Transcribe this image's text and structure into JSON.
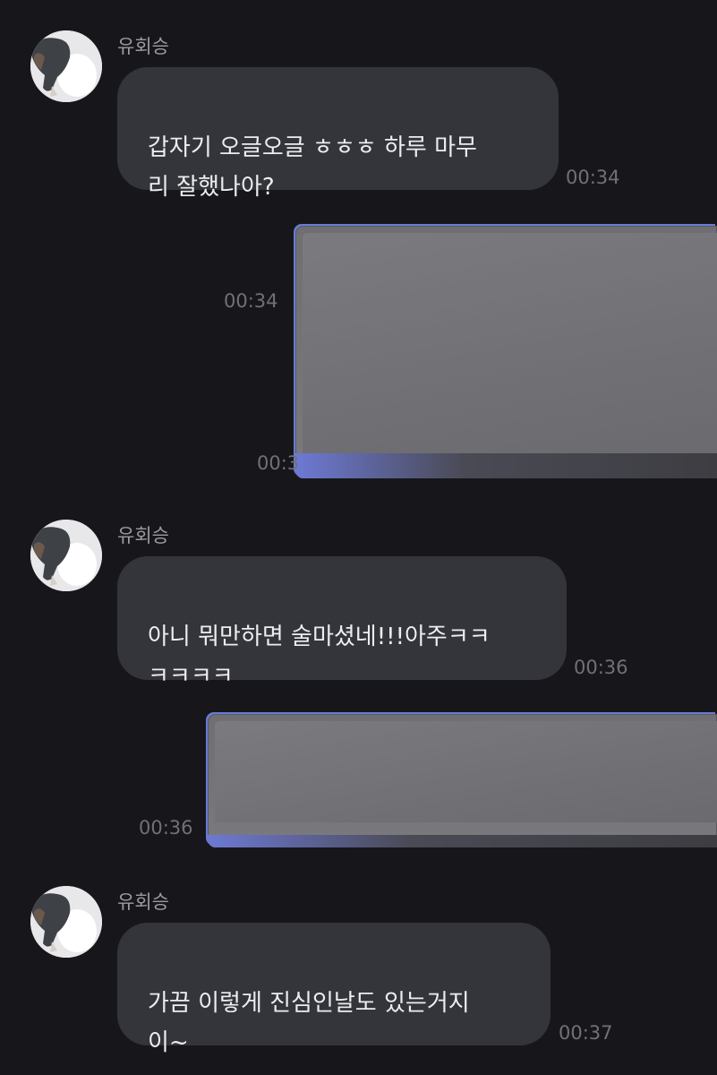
{
  "messages": [
    {
      "sender": "유회승",
      "text": "갑자기 오글오글 ㅎㅎㅎ 하루 마무\n리 잘했나아?",
      "time": "00:34"
    },
    {
      "outgoing_blocked": true,
      "time": "00:34",
      "time_partial": "00:3"
    },
    {
      "sender": "유회승",
      "text": "아니 뭐만하면 술마셨네!!!아주ㅋㅋ\nㅋㅋㅋㅋ",
      "time": "00:36"
    },
    {
      "outgoing_blocked": true,
      "time": "00:36"
    },
    {
      "sender": "유회승",
      "text": "가끔 이렇게 진심인날도 있는거지\n이~",
      "time": "00:37"
    }
  ],
  "colors": {
    "background": "#17171b",
    "bubble": "#34353b",
    "text": "#ededf0",
    "name": "#9b9ba1",
    "time": "#707077"
  }
}
